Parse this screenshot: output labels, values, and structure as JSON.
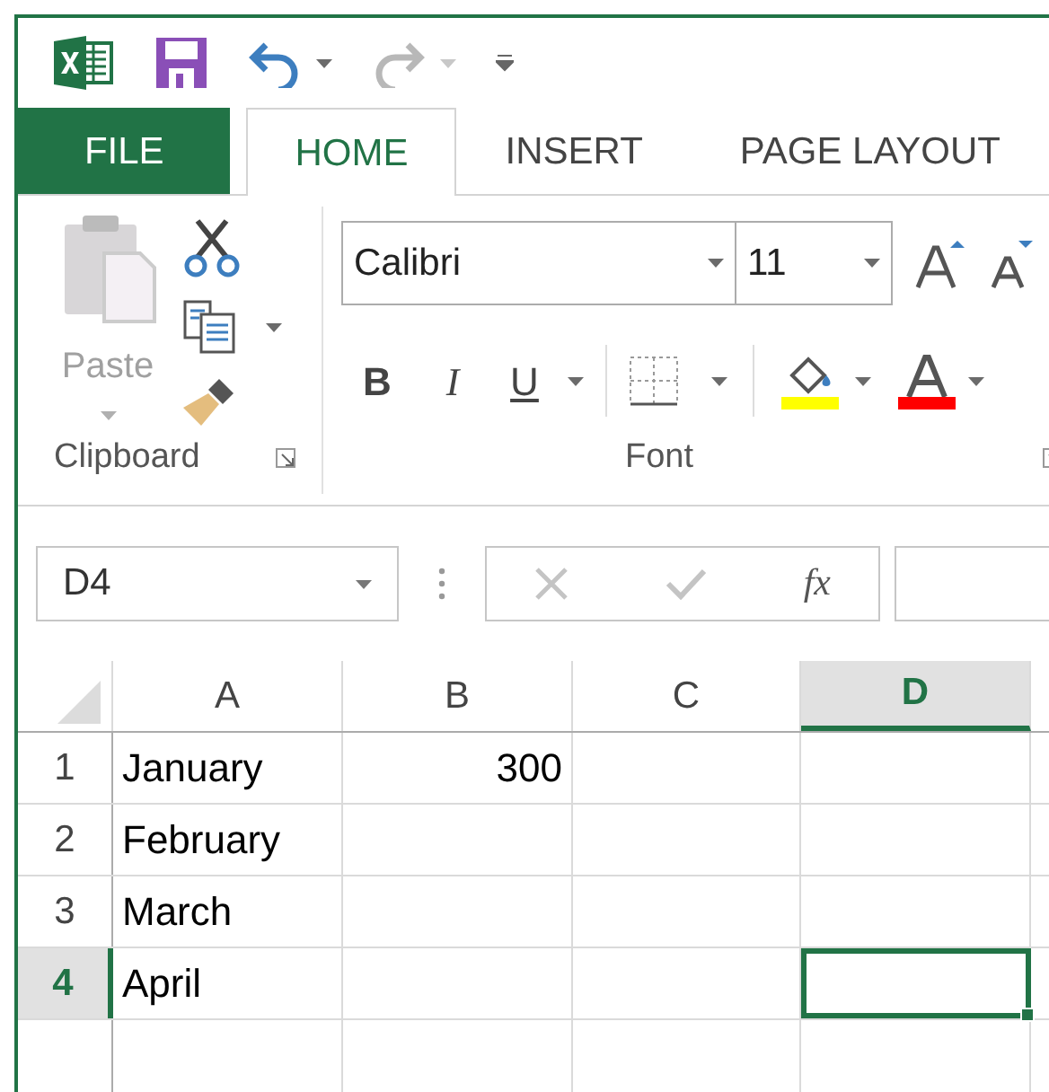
{
  "tabs": [
    {
      "label": "FILE",
      "kind": "file",
      "selected": false
    },
    {
      "label": "HOME",
      "kind": "tab",
      "selected": true
    },
    {
      "label": "INSERT",
      "kind": "tab",
      "selected": false
    },
    {
      "label": "PAGE LAYOUT",
      "kind": "tab",
      "selected": false
    }
  ],
  "clipboard": {
    "paste_label": "Paste",
    "paste_disabled": true,
    "title": "Clipboard"
  },
  "font": {
    "font_name": "Calibri",
    "font_size": "11",
    "bold": "B",
    "italic": "I",
    "underline": "U",
    "title": "Font"
  },
  "formula_bar": {
    "name_box": "D4",
    "function_label": "fx"
  },
  "columns": [
    {
      "label": "A",
      "selected": false
    },
    {
      "label": "B",
      "selected": false
    },
    {
      "label": "C",
      "selected": false
    },
    {
      "label": "D",
      "selected": true
    }
  ],
  "rows": [
    {
      "label": "1",
      "selected": false,
      "cells": [
        {
          "value": "January",
          "active": false
        },
        {
          "value": "300",
          "active": false
        },
        {
          "active": false
        },
        {
          "active": false
        }
      ]
    },
    {
      "label": "2",
      "selected": false,
      "cells": [
        {
          "value": "February",
          "active": false
        },
        {
          "active": false
        },
        {
          "active": false
        },
        {
          "active": false
        }
      ]
    },
    {
      "label": "3",
      "selected": false,
      "cells": [
        {
          "value": "March",
          "active": false
        },
        {
          "active": false
        },
        {
          "active": false
        },
        {
          "active": false
        }
      ]
    },
    {
      "label": "4",
      "selected": true,
      "cells": [
        {
          "value": "April",
          "active": false
        },
        {
          "active": false
        },
        {
          "active": false
        },
        {
          "active": true
        }
      ]
    }
  ]
}
